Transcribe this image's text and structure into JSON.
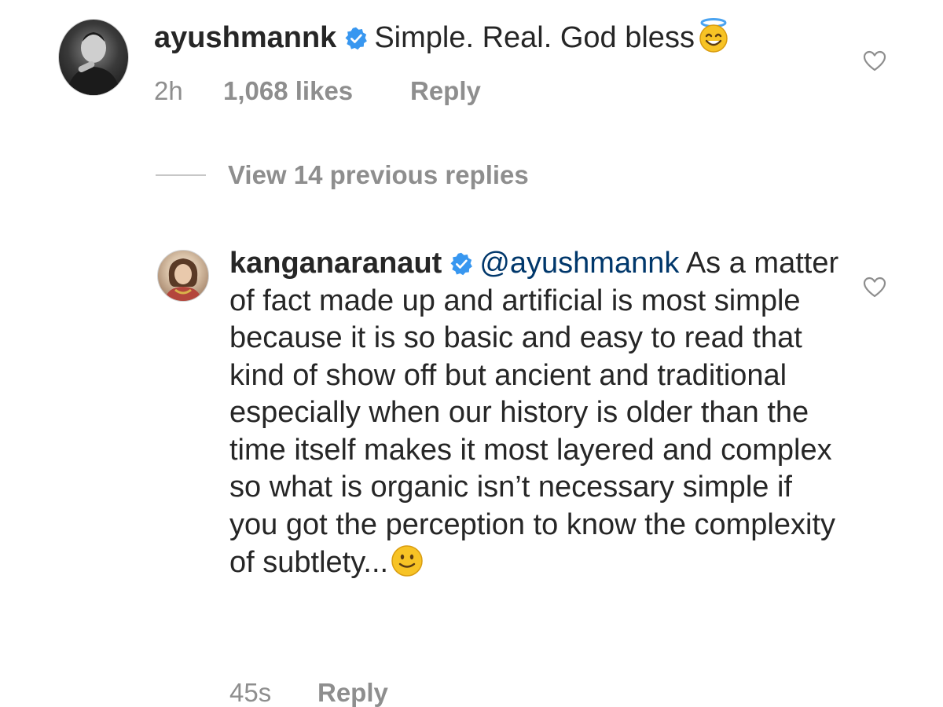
{
  "comment": {
    "username": "ayushmannk",
    "verified": true,
    "text": "Simple. Real. God bless",
    "emoji": "smiling-face-with-halo",
    "time": "2h",
    "likes": "1,068 likes",
    "reply_label": "Reply"
  },
  "view_replies_label": "View 14 previous replies",
  "reply": {
    "username": "kanganaranaut",
    "verified": true,
    "mention": "@ayushmannk",
    "text": " As a matter of fact made up and artificial is most simple because it is so basic and easy to read that kind of show off but ancient and traditional especially when our history is older than the time itself makes it most layered and complex so what is organic isn’t necessary simple if you got the perception to know the complexity of subtlety...",
    "emoji": "slightly-smiling-face",
    "time": "45s",
    "reply_label": "Reply"
  },
  "colors": {
    "text": "#262626",
    "secondary": "#8e8e8e",
    "verified_badge": "#3897f0",
    "mention": "#00376b",
    "emoji_yellow": "#f7c325"
  }
}
